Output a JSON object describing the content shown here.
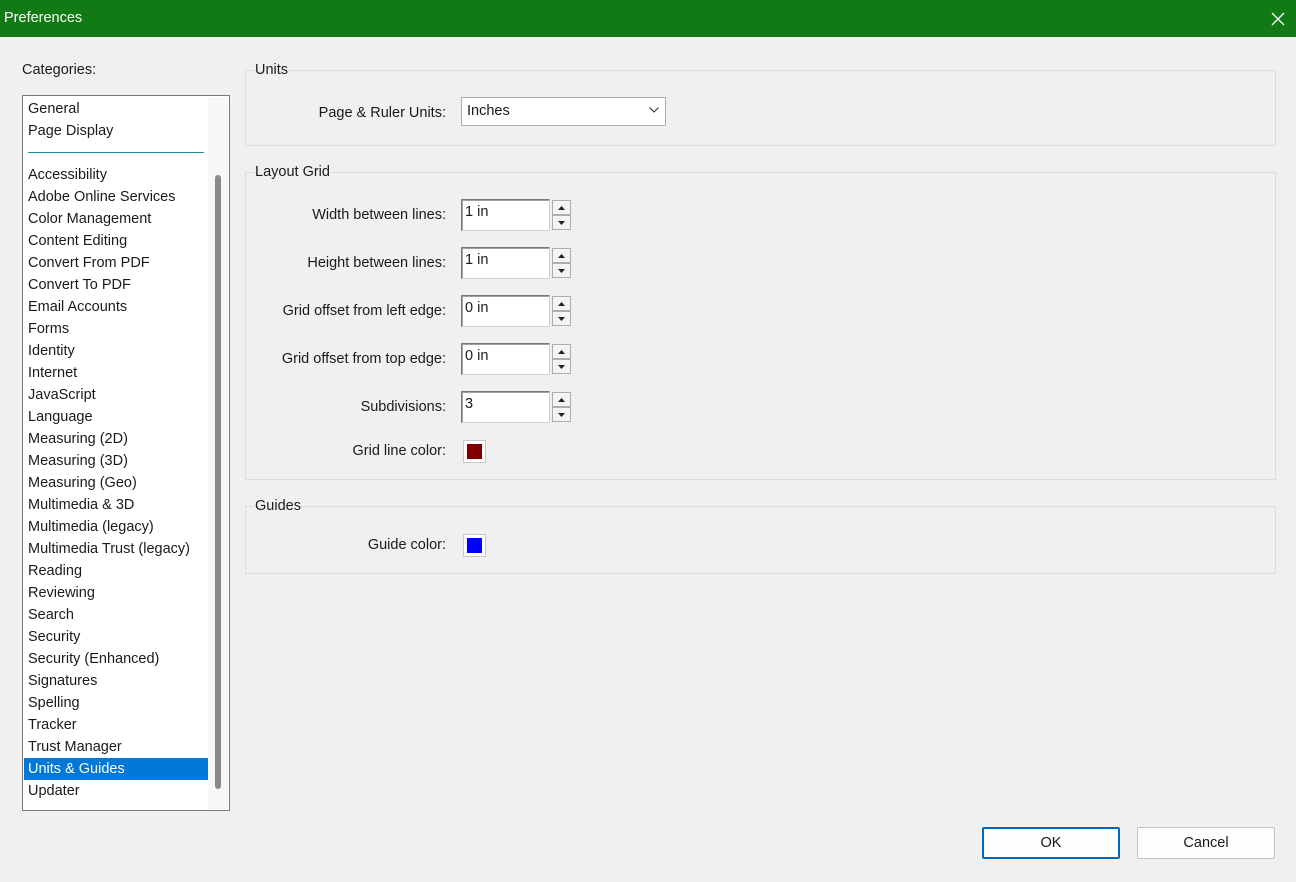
{
  "window": {
    "title": "Preferences"
  },
  "categories": {
    "label": "Categories:",
    "top_items": [
      "General",
      "Page Display"
    ],
    "items": [
      "Accessibility",
      "Adobe Online Services",
      "Color Management",
      "Content Editing",
      "Convert From PDF",
      "Convert To PDF",
      "Email Accounts",
      "Forms",
      "Identity",
      "Internet",
      "JavaScript",
      "Language",
      "Measuring (2D)",
      "Measuring (3D)",
      "Measuring (Geo)",
      "Multimedia & 3D",
      "Multimedia (legacy)",
      "Multimedia Trust (legacy)",
      "Reading",
      "Reviewing",
      "Search",
      "Security",
      "Security (Enhanced)",
      "Signatures",
      "Spelling",
      "Tracker",
      "Trust Manager",
      "Units & Guides",
      "Updater"
    ],
    "selected": "Units & Guides"
  },
  "units": {
    "title": "Units",
    "page_ruler_label": "Page & Ruler Units:",
    "page_ruler_value": "Inches"
  },
  "layout_grid": {
    "title": "Layout Grid",
    "width_label": "Width between lines:",
    "width_value": "1 in",
    "height_label": "Height between lines:",
    "height_value": "1 in",
    "offset_left_label": "Grid offset from left edge:",
    "offset_left_value": "0 in",
    "offset_top_label": "Grid offset from top edge:",
    "offset_top_value": "0 in",
    "subdivisions_label": "Subdivisions:",
    "subdivisions_value": "3",
    "grid_color_label": "Grid line color:",
    "grid_color": "#7f0000"
  },
  "guides": {
    "title": "Guides",
    "guide_color_label": "Guide color:",
    "guide_color": "#0000ff"
  },
  "footer": {
    "ok_label": "OK",
    "cancel_label": "Cancel"
  },
  "colors": {
    "titlebar": "#117a14",
    "selection": "#0078d7"
  }
}
